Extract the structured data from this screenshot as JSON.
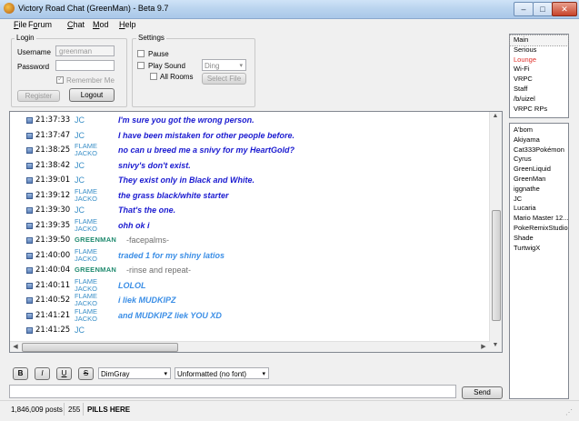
{
  "window": {
    "title": "Victory Road Chat (GreenMan) - Beta 9.7"
  },
  "menu": [
    {
      "label": "File",
      "u": "F",
      "rest": "ile"
    },
    {
      "label": "Forum",
      "u": "o",
      "pre": "F",
      "rest": "rum"
    },
    {
      "label": "Chat",
      "u": "C",
      "rest": "hat"
    },
    {
      "label": "Mod",
      "u": "M",
      "rest": "od"
    },
    {
      "label": "Help",
      "u": "H",
      "rest": "elp"
    }
  ],
  "login": {
    "group_label": "Login",
    "username_label": "Username",
    "username_value": "greenman",
    "password_label": "Password",
    "password_value": "",
    "remember_label": "Remember Me",
    "register_label": "Register",
    "logout_label": "Logout"
  },
  "settings": {
    "group_label": "Settings",
    "pause_label": "Pause",
    "play_sound_label": "Play Sound",
    "all_rooms_label": "All Rooms",
    "sound_value": "Ding",
    "select_file_label": "Select File"
  },
  "channels": [
    "Main",
    "Serious",
    "Lounge",
    "Wi-Fi",
    "VRPC",
    "Staff",
    "/b/uizel",
    "VRPC RPs"
  ],
  "users": [
    "A'bom",
    "Akiyama",
    "Cat333Pokémon",
    "Cyrus",
    "GreenLiquid",
    "GreenMan",
    "iggnathe",
    "JC",
    "Lucaria",
    "Mario Master 12...",
    "PokeRemixStudio",
    "Shade",
    "TurtwigX"
  ],
  "messages": [
    {
      "time": "21:37:33",
      "nick1": "JC",
      "nick2": "",
      "text": "I'm sure you got the wrong person.",
      "style": "jc"
    },
    {
      "time": "21:37:47",
      "nick1": "JC",
      "nick2": "",
      "text": "I have been mistaken for other people before.",
      "style": "jc"
    },
    {
      "time": "21:38:25",
      "nick1": "FLAME",
      "nick2": "JACKO",
      "text": "no can u breed me a snivy for my HeartGold?",
      "style": "flame-dark"
    },
    {
      "time": "21:38:42",
      "nick1": "JC",
      "nick2": "",
      "text": "snivy's don't exist.",
      "style": "jc"
    },
    {
      "time": "21:39:01",
      "nick1": "JC",
      "nick2": "",
      "text": "They exist only in Black and White.",
      "style": "jc"
    },
    {
      "time": "21:39:12",
      "nick1": "FLAME",
      "nick2": "JACKO",
      "text": "the grass black/white starter",
      "style": "flame-dark"
    },
    {
      "time": "21:39:30",
      "nick1": "JC",
      "nick2": "",
      "text": "That's the one.",
      "style": "jc"
    },
    {
      "time": "21:39:35",
      "nick1": "FLAME",
      "nick2": "JACKO",
      "text": "ohh ok i",
      "style": "flame-dark"
    },
    {
      "time": "21:39:50",
      "nick1": "GREENMAN",
      "nick2": "",
      "text": "-facepalms-",
      "style": "green"
    },
    {
      "time": "21:40:00",
      "nick1": "FLAME",
      "nick2": "JACKO",
      "text": "traded 1 for my shiny latios",
      "style": "flame-light"
    },
    {
      "time": "21:40:04",
      "nick1": "GREENMAN",
      "nick2": "",
      "text": "-rinse and repeat-",
      "style": "green"
    },
    {
      "time": "21:40:11",
      "nick1": "FLAME",
      "nick2": "JACKO",
      "text": "LOLOL",
      "style": "flame-light"
    },
    {
      "time": "21:40:52",
      "nick1": "FLAME",
      "nick2": "JACKO",
      "text": "i liek MUDKIPZ",
      "style": "flame-light"
    },
    {
      "time": "21:41:21",
      "nick1": "FLAME",
      "nick2": "JACKO",
      "text": "and MUDKIPZ liek YOU XD",
      "style": "flame-light"
    },
    {
      "time": "21:41:25",
      "nick1": "JC",
      "nick2": "",
      "text": "",
      "style": "jc"
    }
  ],
  "format_toolbar": {
    "bold": "B",
    "italic": "I",
    "underline": "U",
    "strike": "S",
    "color_value": "DimGray",
    "font_value": "Unformatted (no font)"
  },
  "input": {
    "value": "",
    "send_label": "Send"
  },
  "status": {
    "posts": "1,846,009 posts",
    "count": "255",
    "message": "PILLS HERE"
  },
  "colors": {
    "jc": "#1a1ad0",
    "flame_dark": "#1a1ad0",
    "flame_light": "#3b8ee6",
    "green": "#1f8a6e",
    "nick_blue": "#3a8fc7",
    "lounge": "#e0302a",
    "text_gray": "#6e6e6e"
  }
}
